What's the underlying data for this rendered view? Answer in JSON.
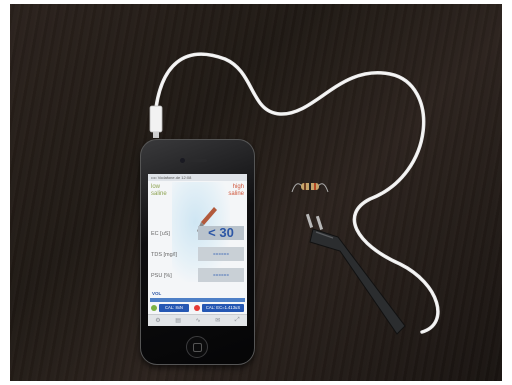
{
  "screen": {
    "status_bar": "•••• Vodafone.de  12:08",
    "range_low": "low\nsaline",
    "range_high": "high\nsaline",
    "ec_label": "EC [uS]",
    "ec_value": "< 30",
    "tds_label": "TDS [mg/l]",
    "tds_value": "------",
    "psu_label": "PSU [%]",
    "psu_value": "------",
    "vol_label": "VOL",
    "cal_left": "CAL: 8xN",
    "cal_right": "CAL: EC=1.413uS",
    "tabs": [
      "⚙",
      "▤",
      "∿",
      "✉",
      "⤢"
    ]
  },
  "colors": {
    "low_text": "#8ca24f",
    "high_text": "#d0573d",
    "value_text": "#2d57a6",
    "cable": "#ececec",
    "probe": "#2b2d2f",
    "wood": "#241c17"
  }
}
